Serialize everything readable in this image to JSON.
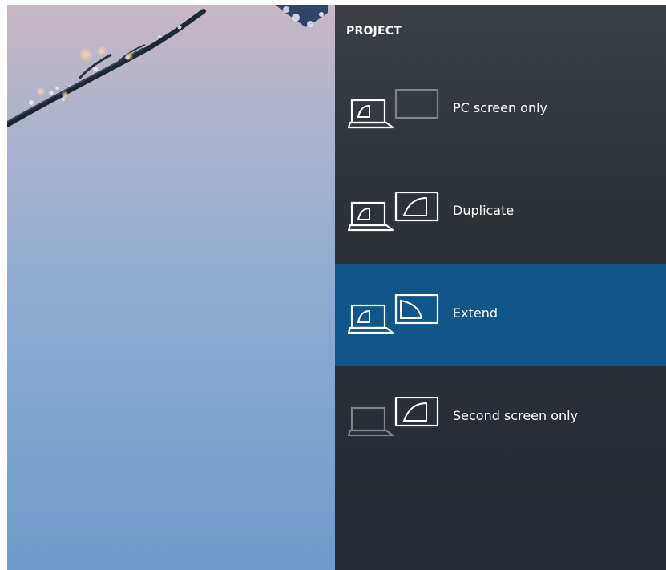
{
  "panel": {
    "title": "PROJECT",
    "options": [
      {
        "id": "pc-screen-only",
        "label": "PC screen only",
        "icon": "pc-screen-only-icon",
        "selected": false
      },
      {
        "id": "duplicate",
        "label": "Duplicate",
        "icon": "duplicate-icon",
        "selected": false
      },
      {
        "id": "extend",
        "label": "Extend",
        "icon": "extend-icon",
        "selected": true
      },
      {
        "id": "second-screen-only",
        "label": "Second screen only",
        "icon": "second-screen-only-icon",
        "selected": false
      }
    ]
  },
  "colors": {
    "panel_bg": "#2e333a",
    "selected_bg": "#10568a",
    "text": "#ffffff",
    "dim_icon": "#7e8388"
  }
}
